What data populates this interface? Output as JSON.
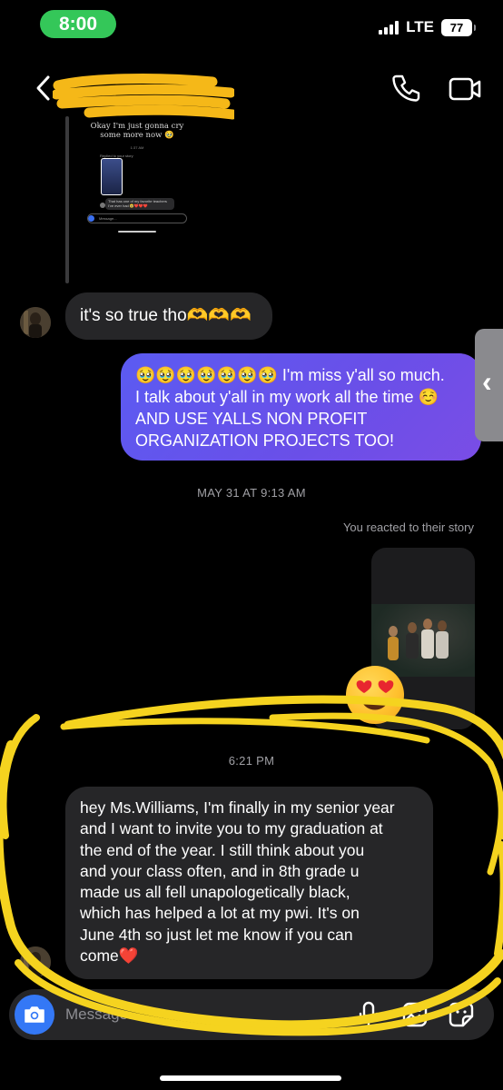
{
  "status_bar": {
    "time": "8:00",
    "network": "LTE",
    "battery": "77"
  },
  "header": {
    "contact_name": ""
  },
  "shared_story": {
    "caption": "Okay I'm just gonna cry some more now 🥹",
    "inner_time": "1:37 AM",
    "inner_label": "Replied to your story",
    "inner_message": "That has one of my favorite teachers I've ever had 🥹❤️❤️❤️",
    "inner_placeholder": "Message..."
  },
  "messages": {
    "msg1": "it's so true tho🫶🫶🫶",
    "sent": "🥹🥹🥹🥹🥹🥹🥹 I'm miss y'all so much.\nI talk about y'all in my work all the time ☺️\nAND USE YALLS NON PROFIT\nORGANIZATION PROJECTS TOO!",
    "timestamp1": "MAY 31 AT 9:13 AM",
    "reacted_note": "You reacted to their story",
    "reaction_emoji": "😍",
    "timestamp2": "6:21 PM",
    "msg2": "hey Ms.Williams, I'm finally in my senior year\nand I want to invite you to my graduation at\nthe end of the year. I still think about you\nand your class often, and in 8th grade u\nmade us all fell unapologetically black,\nwhich has helped a lot at my pwi. It's on\nJune 4th so just let me know if you can\ncome❤️"
  },
  "composer": {
    "placeholder": "Message..."
  },
  "colors": {
    "sent_bubble": "#5b5bf2",
    "received_bubble": "#262628",
    "camera_button": "#3478f6",
    "time_pill": "#34c759",
    "annotation": "#f5d31f"
  },
  "icons": [
    "back-chevron-icon",
    "phone-icon",
    "video-camera-icon",
    "camera-icon",
    "microphone-icon",
    "gallery-icon",
    "sticker-icon"
  ]
}
